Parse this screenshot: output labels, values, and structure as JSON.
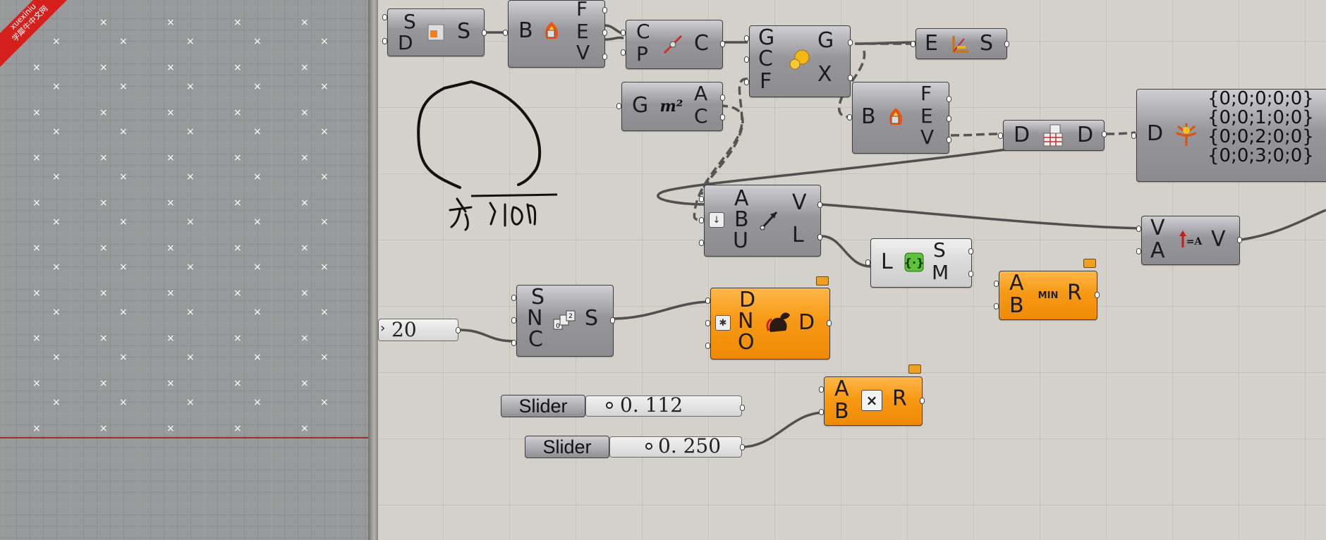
{
  "watermark": {
    "line1": "xuexiniu",
    "line2": "学犀牛中文网"
  },
  "sketch_text": "方向",
  "components": {
    "srf_domain": {
      "in": [
        "S",
        "D"
      ],
      "out": [
        "S"
      ],
      "icon": "surface-subdivide-icon"
    },
    "brep_edges_1": {
      "in": [
        "B"
      ],
      "out": [
        "F",
        "E",
        "V"
      ],
      "icon": "brep-edges-icon"
    },
    "curve_closest": {
      "in": [
        "C",
        "P"
      ],
      "out": [
        "C"
      ],
      "icon": "curve-closest-point-icon"
    },
    "geometry_center": {
      "in": [
        "G",
        "C",
        "F"
      ],
      "out": [
        "G",
        "X"
      ],
      "icon": "spheres-icon"
    },
    "edge_surface": {
      "in": [
        "E"
      ],
      "out": [
        "S"
      ],
      "icon": "edge-surface-icon"
    },
    "area": {
      "in": [
        "G"
      ],
      "out": [
        "A",
        "C"
      ],
      "icon": "area-icon",
      "icon_text": "m²"
    },
    "brep_edges_2": {
      "in": [
        "B"
      ],
      "out": [
        "F",
        "E",
        "V"
      ],
      "icon": "brep-edges-icon"
    },
    "divide_domain": {
      "in": [
        "D"
      ],
      "out": [
        "D"
      ],
      "icon": "divide-domain-icon"
    },
    "data_tree": {
      "in": [
        "D"
      ],
      "icon": "param-viewer-icon",
      "items": [
        "{0;0;0;0;0}",
        "{0;0;1;0;0}",
        "{0;0;2;0;0}",
        "{0;0;3;0;0}"
      ]
    },
    "vector_2pt": {
      "in": [
        "A",
        "B",
        "U"
      ],
      "out": [
        "V",
        "L"
      ],
      "icon": "vector-two-point-icon"
    },
    "list_item": {
      "in": [
        "L"
      ],
      "out": [
        "S",
        "M"
      ],
      "icon": "list-item-icon"
    },
    "amplitude": {
      "in": [
        "V",
        "A"
      ],
      "out": [
        "V"
      ],
      "icon": "amplitude-icon"
    },
    "minimum": {
      "in": [
        "A",
        "B"
      ],
      "out": [
        "R"
      ],
      "icon_text": "MIN"
    },
    "series": {
      "in": [
        "S",
        "N",
        "C"
      ],
      "out": [
        "S"
      ],
      "icon": "series-icon"
    },
    "dispatch": {
      "in": [
        "D",
        "N",
        "O"
      ],
      "out": [
        "D"
      ],
      "icon": "dispatch-icon"
    },
    "multiplication": {
      "in": [
        "A",
        "B"
      ],
      "out": [
        "R"
      ],
      "icon": "multiplication-icon"
    }
  },
  "number_param": {
    "value": "20"
  },
  "sliders": [
    {
      "label": "Slider",
      "value": "0. 112"
    },
    {
      "label": "Slider",
      "value": "0. 250"
    }
  ],
  "colors": {
    "canvas": "#d3d1ca",
    "component": "#96969b",
    "component_selected": "#f79914",
    "wire": "#505050"
  }
}
